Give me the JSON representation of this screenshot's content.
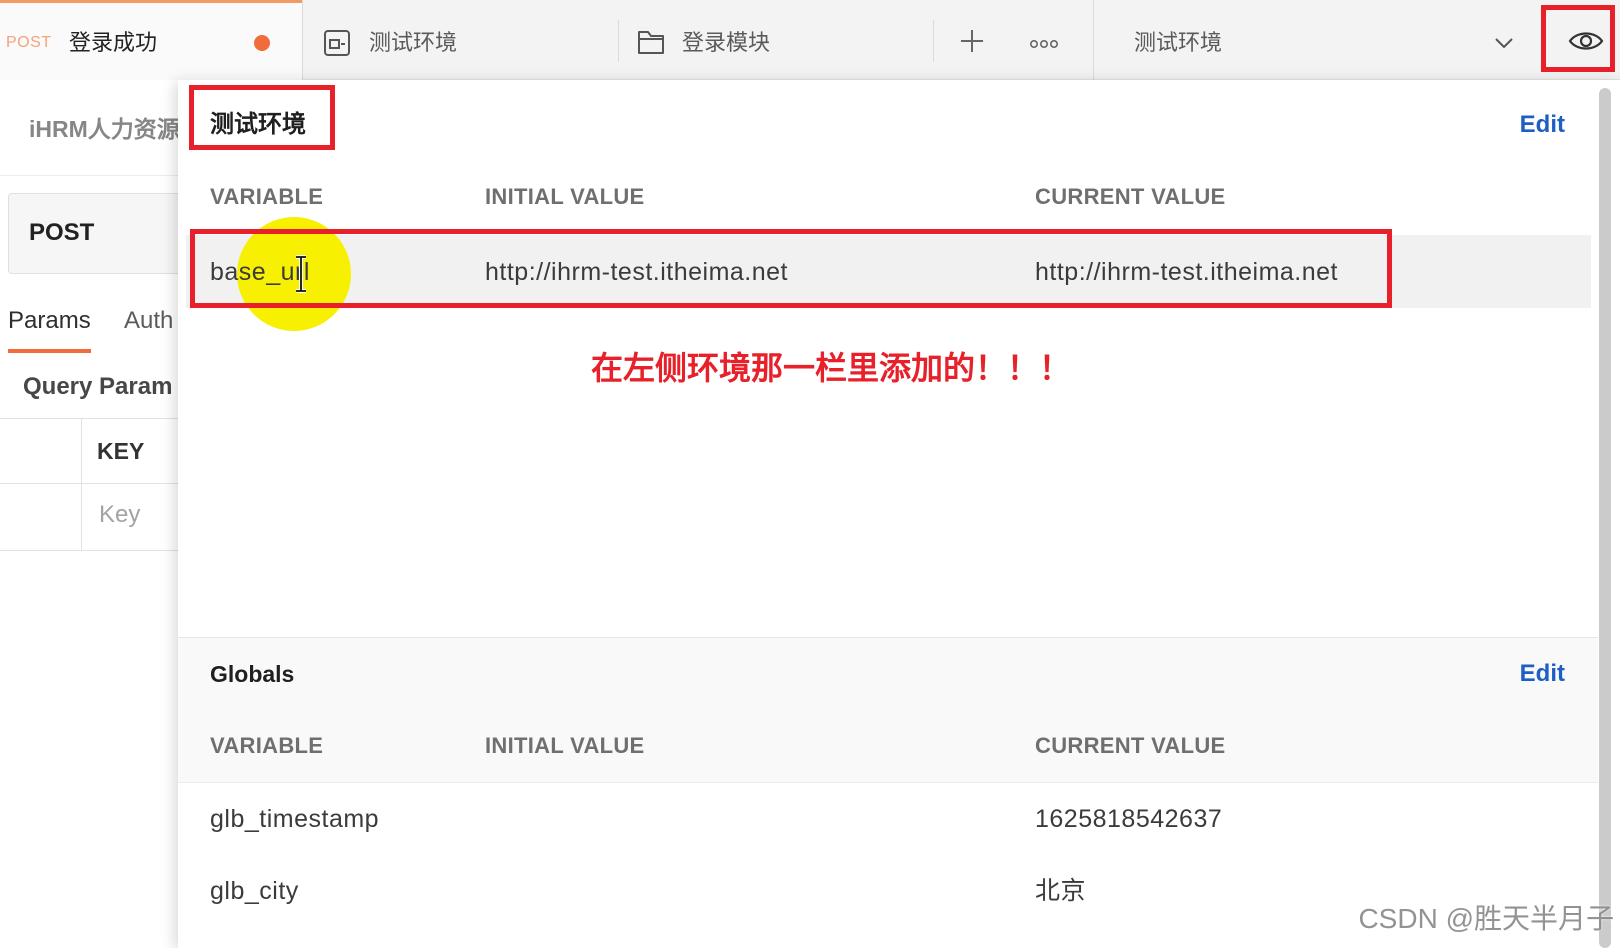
{
  "tabs": [
    {
      "method": "POST",
      "label": "登录成功",
      "unsaved_icon": "unsaved-dot-icon"
    },
    {
      "icon": "environment-icon",
      "label": "测试环境"
    },
    {
      "icon": "folder-icon",
      "label": "登录模块"
    }
  ],
  "tab_actions": {
    "new_tab_icon": "plus-icon",
    "more_icon": "more-horizontal-icon"
  },
  "environment_selector": {
    "selected": "测试环境",
    "icon": "chevron-down-icon"
  },
  "environment_quick_look": {
    "icon": "eye-icon"
  },
  "request": {
    "collection_title": "iHRM人力资源",
    "method": "POST",
    "tabs": [
      "Params",
      "Auth"
    ],
    "section_title": "Query Param",
    "params_table": {
      "key_header": "KEY",
      "key_placeholder": "Key"
    }
  },
  "quick_look": {
    "environment": {
      "name": "测试环境",
      "edit_label": "Edit",
      "columns": [
        "VARIABLE",
        "INITIAL VALUE",
        "CURRENT VALUE"
      ],
      "rows": [
        {
          "variable": "base_url",
          "initial_value": "http://ihrm-test.itheima.net",
          "current_value": "http://ihrm-test.itheima.net"
        }
      ]
    },
    "globals": {
      "name": "Globals",
      "edit_label": "Edit",
      "columns": [
        "VARIABLE",
        "INITIAL VALUE",
        "CURRENT VALUE"
      ],
      "rows": [
        {
          "variable": "glb_timestamp",
          "current_value": "1625818542637"
        },
        {
          "variable": "glb_city",
          "current_value": "北京"
        }
      ]
    }
  },
  "annotation": {
    "text": "在左侧环境那一栏里添加的！！！",
    "cursor_icon": "text-cursor-icon"
  },
  "watermark": "CSDN @胜天半月子",
  "colors": {
    "accent": "#f26b3a",
    "active_tab_line": "#f39a63",
    "link": "#1d5fc3",
    "annotation_red": "#e8202a",
    "highlight_yellow": "#f7f000"
  }
}
